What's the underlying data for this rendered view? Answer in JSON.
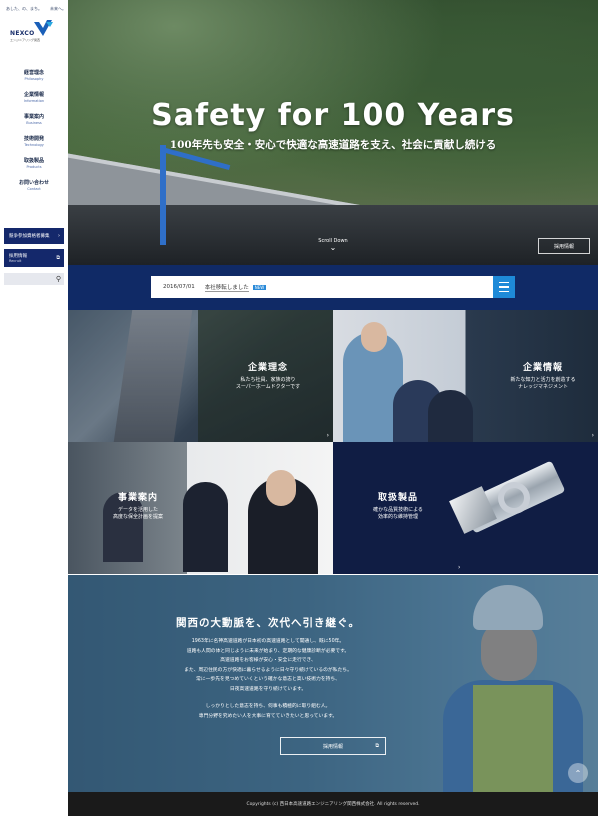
{
  "sidebar": {
    "tagline": "あした、の、まち。　　未来へ。",
    "logo_text": "NEXCO",
    "logo_sub": "エンジニアリング関西",
    "nav": [
      {
        "jp": "経営理念",
        "en": "Philosophy"
      },
      {
        "jp": "企業情報",
        "en": "Information"
      },
      {
        "jp": "事業案内",
        "en": "Business"
      },
      {
        "jp": "技術開発",
        "en": "Technology"
      },
      {
        "jp": "取扱製品",
        "en": "Products"
      },
      {
        "jp": "お問い合わせ",
        "en": "Contact"
      }
    ],
    "btn_bid": "競争参加資格者募集",
    "btn_recruit_jp": "採用情報",
    "btn_recruit_en": "Recruit"
  },
  "hero": {
    "title": "Safety for 100 Years",
    "subtitle": "100年先も安全・安心で快適な高速道路を支え、社会に貢献し続ける",
    "scroll_label": "Scroll Down",
    "recruit_label": "採用情報"
  },
  "news": {
    "date": "2016/07/01",
    "title": "本社移転しました",
    "badge": "NEW"
  },
  "tiles": [
    {
      "title": "企業理念",
      "desc": [
        "私たち社員、家族の誇り",
        "スーパーホームドクターです"
      ]
    },
    {
      "title": "企業情報",
      "desc": [
        "新たな知力と活力を創造する",
        "ナレッジマネジメント"
      ]
    },
    {
      "title": "事業案内",
      "desc": [
        "データを活用した",
        "高度な保全計画を提案"
      ]
    },
    {
      "title": "取扱製品",
      "desc": [
        "確かな品質技術による",
        "効率的な維持管理"
      ]
    }
  ],
  "promo": {
    "title": "関西の大動脈を、次代へ引き継ぐ。",
    "lines": [
      "1963年に名神高速道路が日本初の高速道路として開通し、既に50年。",
      "道路も人間の体と同じように未来が始まり、定期的な健康診断が必要です。",
      "高速道路をお客様が安心・安全に走行でき、",
      "また、周辺住民の方が快適に暮らせるように日々守り続けているのが私たち。",
      "常に一歩先を見つめていくという確かな意志と高い技術力を持ち、",
      "日夜高速道路を守り続けています。"
    ],
    "lines2": [
      "しっかりとした意志を持ち、何事も積極的に取り組む人。",
      "専門分野を究めたい人を大事に育てていきたいと思っています。"
    ],
    "button": "採用情報"
  },
  "footer": {
    "copyright": "Copyrights (c) 西日本高速道路エンジニアリング関西株式会社. All rights reserved."
  }
}
